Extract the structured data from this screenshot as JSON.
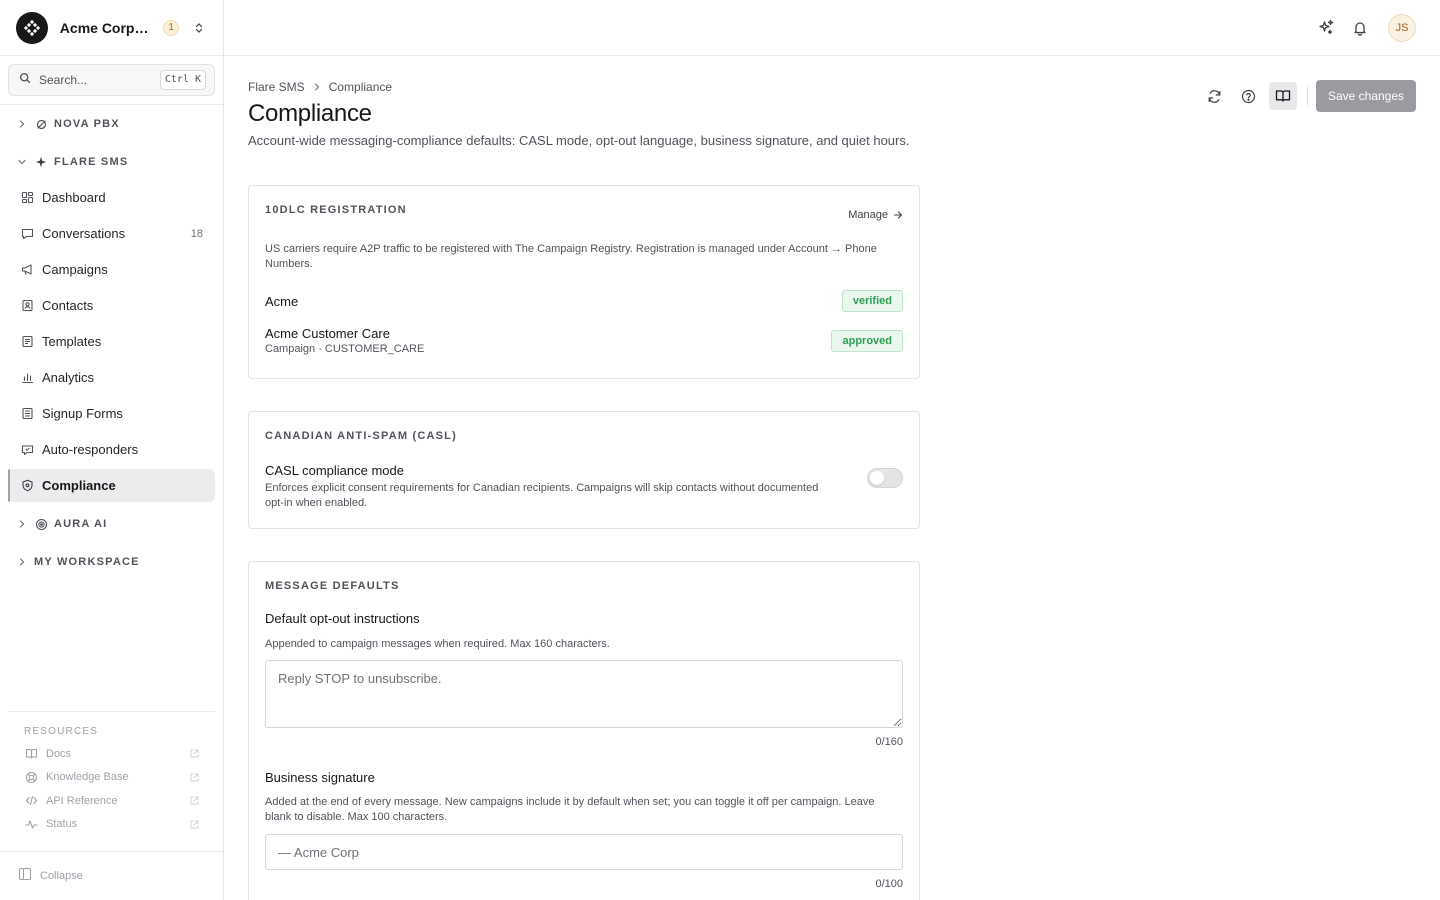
{
  "org": {
    "name": "Acme Corporation",
    "badge": "1"
  },
  "search": {
    "label": "Search...",
    "shortcut": "Ctrl K"
  },
  "sidebar": {
    "groups": [
      {
        "label": "NOVA PBX",
        "icon": "pbx-icon",
        "expanded": false
      },
      {
        "label": "FLARE SMS",
        "icon": "sparkle-icon",
        "expanded": true
      },
      {
        "label": "AURA AI",
        "icon": "ai-icon",
        "expanded": false
      },
      {
        "label": "MY WORKSPACE",
        "icon": "",
        "expanded": false
      }
    ],
    "items": [
      {
        "label": "Dashboard",
        "icon": "dashboard-icon",
        "count": ""
      },
      {
        "label": "Conversations",
        "icon": "chat-icon",
        "count": "18"
      },
      {
        "label": "Campaigns",
        "icon": "megaphone-icon",
        "count": ""
      },
      {
        "label": "Contacts",
        "icon": "contact-card-icon",
        "count": ""
      },
      {
        "label": "Templates",
        "icon": "template-icon",
        "count": ""
      },
      {
        "label": "Analytics",
        "icon": "bar-chart-icon",
        "count": ""
      },
      {
        "label": "Signup Forms",
        "icon": "form-icon",
        "count": ""
      },
      {
        "label": "Auto-responders",
        "icon": "auto-reply-icon",
        "count": ""
      },
      {
        "label": "Compliance",
        "icon": "shield-icon",
        "count": "",
        "active": true
      }
    ]
  },
  "resources": {
    "title": "RESOURCES",
    "items": [
      {
        "label": "Docs",
        "icon": "book-icon"
      },
      {
        "label": "Knowledge Base",
        "icon": "lifebuoy-icon"
      },
      {
        "label": "API Reference",
        "icon": "code-icon"
      },
      {
        "label": "Status",
        "icon": "activity-icon"
      }
    ]
  },
  "collapse_label": "Collapse",
  "user": {
    "initials": "JS"
  },
  "breadcrumb": {
    "parent": "Flare SMS",
    "current": "Compliance"
  },
  "page": {
    "title": "Compliance",
    "subtitle": "Account-wide messaging-compliance defaults: CASL mode, opt-out language, business signature, and quiet hours."
  },
  "toolbar": {
    "save_label": "Save changes"
  },
  "registration": {
    "title": "10DLC REGISTRATION",
    "manage_label": "Manage",
    "description": "US carriers require A2P traffic to be registered with The Campaign Registry. Registration is managed under Account → Phone Numbers.",
    "brand": {
      "name": "Acme",
      "status": "verified"
    },
    "campaign": {
      "name": "Acme Customer Care",
      "meta": "Campaign · CUSTOMER_CARE",
      "status": "approved"
    }
  },
  "casl": {
    "title": "CANADIAN ANTI-SPAM (CASL)",
    "option_label": "CASL compliance mode",
    "option_desc": "Enforces explicit consent requirements for Canadian recipients. Campaigns will skip contacts without documented opt-in when enabled.",
    "enabled": false
  },
  "defaults": {
    "title": "MESSAGE DEFAULTS",
    "optout": {
      "label": "Default opt-out instructions",
      "help": "Appended to campaign messages when required. Max 160 characters.",
      "placeholder": "Reply STOP to unsubscribe.",
      "value": "",
      "counter": "0/160"
    },
    "signature": {
      "label": "Business signature",
      "help": "Added at the end of every message. New campaigns include it by default when set; you can toggle it off per campaign. Leave blank to disable. Max 100 characters.",
      "placeholder": "— Acme Corp",
      "value": "",
      "counter": "0/100"
    }
  },
  "colors": {
    "accent": "#18181b",
    "status_green": "#2e9e55",
    "save_button_disabled": "#9a9aa1"
  }
}
